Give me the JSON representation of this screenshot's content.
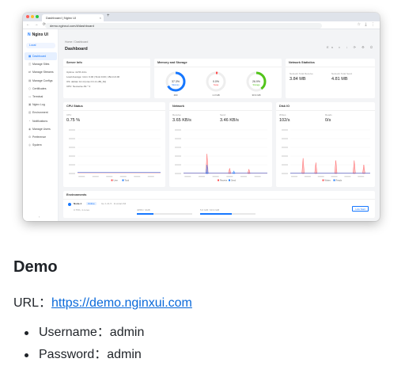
{
  "browser": {
    "tab_title": "Dashboard | Nginx UI",
    "tab_close": "×",
    "new_tab": "+",
    "nav_icons": "← → ⟳",
    "url": "demo.nginxui.com/#/dashboard",
    "actions": "☆ ⤓ ⋮"
  },
  "sidebar": {
    "logo": "Nginx UI",
    "logo_mark": "N",
    "location": "Local",
    "items": [
      {
        "label": "Dashboard",
        "icon": "▦"
      },
      {
        "label": "Manage Sites",
        "icon": "◫"
      },
      {
        "label": "Manage Streams",
        "icon": "⇄"
      },
      {
        "label": "Manage Configs",
        "icon": "▤"
      },
      {
        "label": "Certificates",
        "icon": "⬡"
      },
      {
        "label": "Terminal",
        "icon": "▭"
      },
      {
        "label": "Nginx Log",
        "icon": "▣"
      },
      {
        "label": "Environment",
        "icon": "▥"
      },
      {
        "label": "Notifications",
        "icon": "◔"
      },
      {
        "label": "Manage Users",
        "icon": "◉"
      },
      {
        "label": "Preference",
        "icon": "⚙"
      },
      {
        "label": "System",
        "icon": "◎"
      }
    ],
    "collapse": "‹"
  },
  "main": {
    "breadcrumb": "Home / Dashboard",
    "title": "Dashboard",
    "top_right": "En ◐ ↓ ⟳ ⚙ ⏻"
  },
  "server_info": {
    "title": "Server Info",
    "uptime": "Uptime: 4d 5h 44m",
    "load": "Load Average: 1min: 0.00 | 5min:0.00 | 15min:0.00",
    "os": "OS: debian 12.4 (Linux 6.1.0-x86_64)",
    "cpu": "CPU: Neoverse-N1 * 4"
  },
  "memory_storage": {
    "title": "Memory and Storage",
    "gauges": [
      {
        "label": "Memory",
        "value": "37.3%",
        "sub": "2Mi",
        "color": "#1677ff",
        "pct": 0.66
      },
      {
        "label": "Swap",
        "value": "0.0%",
        "sub": "1.3 GB",
        "color": "#ff4d4f",
        "pct": 0.03
      },
      {
        "label": "Storage",
        "value": "26.9%",
        "sub": "30.9 GB",
        "color": "#52c41a",
        "pct": 0.4
      }
    ]
  },
  "network_stats": {
    "title": "Network Statistics",
    "receive_label": "Network Total Receive",
    "receive_value": "3.84 MB",
    "send_label": "Network Total Send",
    "send_value": "4.81 MB"
  },
  "cpu_status": {
    "title": "CPU Status",
    "label": "CPU",
    "value": "0.75 %",
    "legend": [
      "User",
      "Total"
    ]
  },
  "network": {
    "title": "Network",
    "receive_label": "Receive",
    "receive_value": "3.65 KB/s",
    "send_label": "Send",
    "send_value": "3.46 KB/s",
    "legend": [
      "Receive",
      "Send"
    ]
  },
  "disk_io": {
    "title": "Disk IO",
    "reads_label": "Writes",
    "reads_value": "102/s",
    "writes_label": "Reads",
    "writes_value": "0/s",
    "legend": [
      "Writes",
      "Reads"
    ]
  },
  "environments": {
    "title": "Environments",
    "node_name": "Node-1",
    "node_badge": "Online",
    "node_meta": "Go 1.21.5 · linux/arm64",
    "cpu_text": "0.75%, 4 cores",
    "memory_text": "405M / 4GiB",
    "disk_text": "5.6 GiB / 30.9 GiB",
    "link_button": "Link Start",
    "mem_pct": 0.3,
    "disk_pct": 0.57
  },
  "below": {
    "heading": "Demo",
    "url_prefix": "URL：",
    "url": "https://demo.nginxui.com",
    "username": "Username：admin",
    "password": "Password：admin"
  }
}
